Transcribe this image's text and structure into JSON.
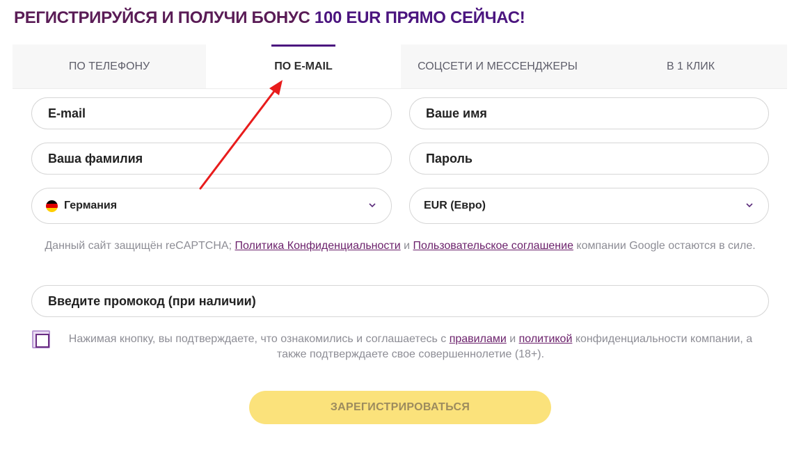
{
  "headline": {
    "lead": "РЕГИСТРИРУЙСЯ И ПОЛУЧИ БОНУС",
    "accent": "100 EUR ПРЯМО СЕЙЧАС!"
  },
  "tabs": [
    {
      "label": "ПО ТЕЛЕФОНУ",
      "active": false
    },
    {
      "label": "ПО E-MAIL",
      "active": true
    },
    {
      "label": "СОЦСЕТИ И МЕССЕНДЖЕРЫ",
      "active": false
    },
    {
      "label": "В 1 КЛИК",
      "active": false
    }
  ],
  "form": {
    "email_placeholder": "E-mail",
    "name_placeholder": "Ваше имя",
    "surname_placeholder": "Ваша фамилия",
    "password_placeholder": "Пароль",
    "country_value": "Германия",
    "currency_value": "EUR (Евро)",
    "promo_placeholder": "Введите промокод (при наличии)"
  },
  "captcha": {
    "text_before": "Данный сайт защищён reCAPTCHA;",
    "privacy_link": "Политика Конфиденциальности",
    "and": "и",
    "terms_link": "Пользовательское соглашение",
    "text_after": "компании Google остаются в силе."
  },
  "agreement": {
    "text_before": "Нажимая кнопку, вы подтверждаете, что ознакомились и соглашаетесь с",
    "rules_link": "правилами",
    "and": "и",
    "policy_link": "политикой",
    "text_after": "конфиденциальности компании, а также подтверждаете свое совершеннолетие (18+)."
  },
  "submit_label": "ЗАРЕГИСТРИРОВАТЬСЯ",
  "icons": {
    "country_flag": "germany-flag-icon",
    "dropdown": "chevron-down-icon"
  },
  "colors": {
    "brand_purple": "#4b157f",
    "headline": "#5a1c56",
    "button_yellow": "#fbe27b",
    "annotation_arrow": "#e81c1c",
    "flag_black": "#000000",
    "flag_red": "#dd0000",
    "flag_gold": "#ffce00"
  }
}
